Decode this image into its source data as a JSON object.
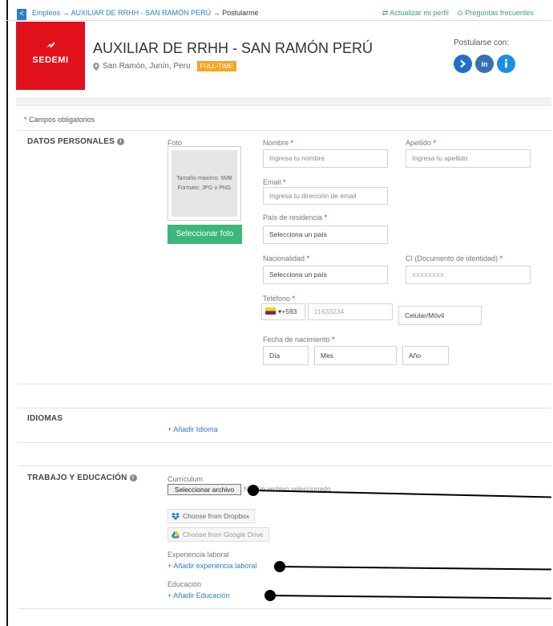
{
  "breadcrumb": {
    "back": "<",
    "root": "Empleos",
    "sep": "→",
    "job": "AUXILIAR DE RRHH - SAN RAMÓN PERÚ",
    "current": "Postularme"
  },
  "top_links": {
    "update_profile": "⇄ Actualizar mi perfil",
    "faq": "⊙ Preguntas frecuentes"
  },
  "company": {
    "logo_text": "SEDEMI",
    "color": "#e0111b"
  },
  "job": {
    "title": "AUXILIAR DE RRHH - SAN RAMÓN PERÚ",
    "location": "San Ramón, Junín, Peru",
    "type": "FULL-TIME"
  },
  "apply_with": {
    "label": "Postularse con:",
    "icons": [
      "arrow-icon",
      "linkedin-icon",
      "info-icon"
    ]
  },
  "required_note": {
    "star": "*",
    "text": "Campos obligatorios"
  },
  "personal": {
    "section_title": "DATOS PERSONALES",
    "photo_label": "Foto",
    "photo_hint_1": "Tamaño maximo: 5MB",
    "photo_hint_2": "Formato: JPG o PNG",
    "photo_button": "Seleccionar foto",
    "nombre_label": "Nombre",
    "nombre_placeholder": "Ingresa tu nombre",
    "apellido_label": "Apellido",
    "apellido_placeholder": "Ingresa tu apellido",
    "email_label": "Email",
    "email_placeholder": "Ingresa tu dirección de email",
    "pais_label": "País de residencia",
    "pais_value": "Selecciona un país",
    "nacionalidad_label": "Nacionalidad",
    "nacionalidad_value": "Selecciona un país",
    "ci_label": "CI (Documento de identidad)",
    "ci_placeholder": "XXXXXXXX",
    "telefono_label": "Teléfono",
    "phone_code": "▾+593",
    "phone_placeholder": "11633234",
    "phone_type": "Celular/Móvil",
    "fecha_label": "Fecha de nacimiento",
    "dia": "Día",
    "mes": "Mes",
    "anio": "Año",
    "star": "*"
  },
  "idiomas": {
    "section_title": "IDIOMAS",
    "add": "+ Añadir Idioma"
  },
  "trabajo": {
    "section_title": "TRABAJO Y EDUCACIÓN",
    "curriculum_label": "Currículum",
    "file_button": "Seleccionar archivo",
    "file_status": "Ningún archivo seleccionado",
    "dropbox": "Choose from Dropbox",
    "gdrive": "Choose from Google Drive",
    "experiencia_label": "Experiencia laboral",
    "experiencia_add": "+ Añadir experiencia laboral",
    "educacion_label": "Educación",
    "educacion_add": "+ Añadir Educación"
  }
}
